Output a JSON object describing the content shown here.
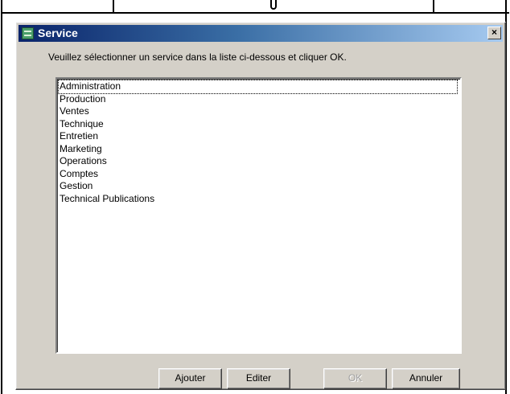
{
  "window": {
    "title": "Service",
    "close_label": "×"
  },
  "instruction": "Veuillez sélectionner un service dans la liste ci-dessous et cliquer OK.",
  "list": {
    "selected_index": 0,
    "items": [
      "Administration",
      "Production",
      "Ventes",
      "Technique",
      "Entretien",
      "Marketing",
      "Operations",
      "Comptes",
      "Gestion",
      "Technical Publications"
    ]
  },
  "buttons": {
    "ajouter": "Ajouter",
    "editer": "Editer",
    "ok": "OK",
    "annuler": "Annuler"
  }
}
